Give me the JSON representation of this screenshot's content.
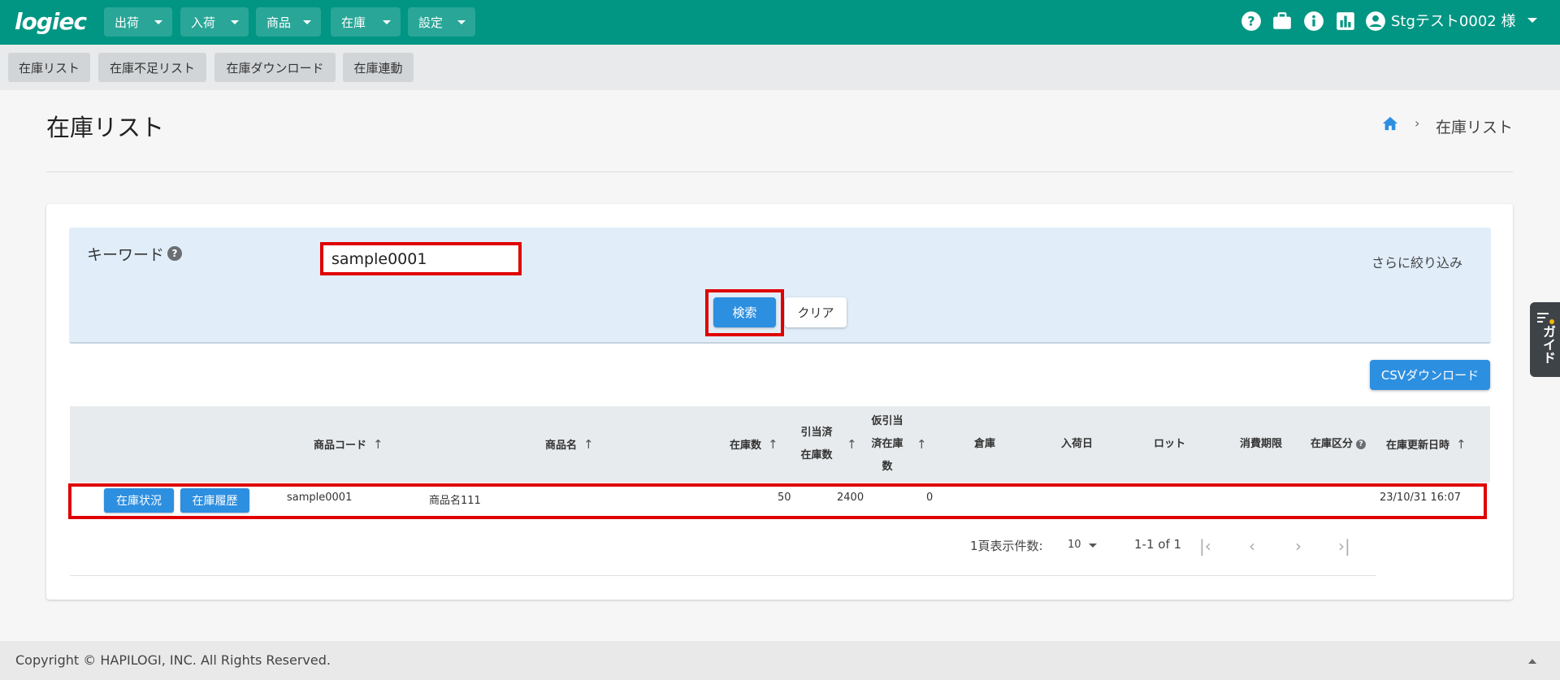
{
  "header": {
    "logo_text": "logiec",
    "nav": [
      {
        "label": "出荷"
      },
      {
        "label": "入荷"
      },
      {
        "label": "商品"
      },
      {
        "label": "在庫"
      },
      {
        "label": "設定"
      }
    ],
    "icons": [
      "help-icon",
      "briefcase-icon",
      "info-icon",
      "chart-icon",
      "account-icon"
    ],
    "user_name": "Stgテスト0002 様"
  },
  "subnav": {
    "items": [
      {
        "label": "在庫リスト"
      },
      {
        "label": "在庫不足リスト"
      },
      {
        "label": "在庫ダウンロード"
      },
      {
        "label": "在庫連動"
      }
    ]
  },
  "page": {
    "title": "在庫リスト",
    "breadcrumb_sep": "›",
    "breadcrumb_current": "在庫リスト"
  },
  "search": {
    "keyword_label": "キーワード",
    "keyword_help": "?",
    "keyword_value": "sample0001",
    "more_filter": "さらに絞り込み",
    "search_label": "検索",
    "clear_label": "クリア"
  },
  "csv_label": "CSVダウンロード",
  "table": {
    "headers": {
      "code": "商品コード",
      "name": "商品名",
      "stock": "在庫数",
      "allocated_1": "引当済",
      "allocated_2": "在庫数",
      "temp_1": "仮引当",
      "temp_2": "済在庫",
      "temp_3": "数",
      "warehouse": "倉庫",
      "arrival": "入荷日",
      "lot": "ロット",
      "expiry": "消費期限",
      "category": "在庫区分",
      "updated": "在庫更新日時",
      "sort_arrow": "↑"
    },
    "row": {
      "status_btn": "在庫状況",
      "history_btn": "在庫履歴",
      "code": "sample0001",
      "name": "商品名111",
      "stock": "50",
      "allocated": "2400",
      "temp": "0",
      "updated": "23/10/31 16:07"
    }
  },
  "pagination": {
    "per_page_label": "1頁表示件数:",
    "per_page_value": "10",
    "range": "1-1 of 1",
    "first": "|‹",
    "prev": "‹",
    "next": "›",
    "last": "›|"
  },
  "guide_label": "ガイド",
  "footer": {
    "copyright": "Copyright © HAPILOGI, INC. All Rights Reserved."
  },
  "colors": {
    "brand": "#009683",
    "primary_button": "#2d8fe0",
    "highlight": "#e00000"
  }
}
